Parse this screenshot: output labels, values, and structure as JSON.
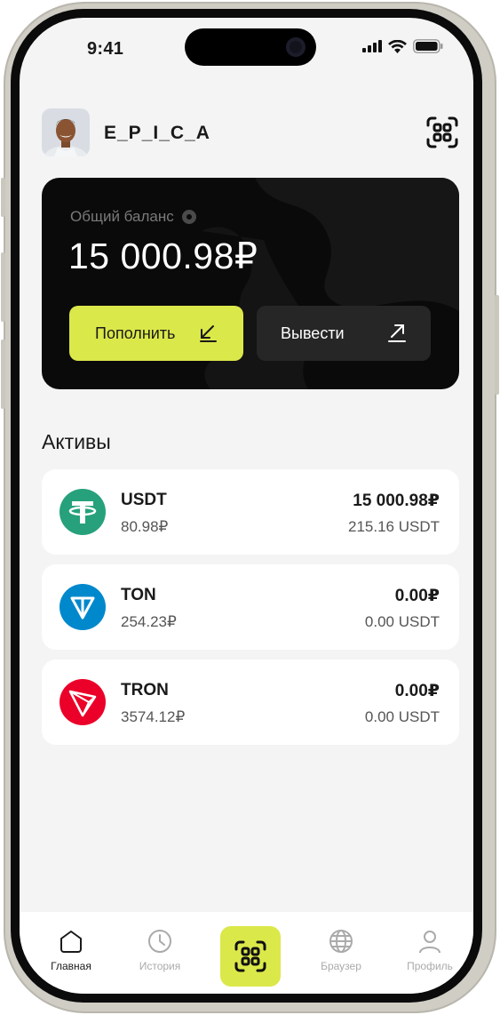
{
  "status_bar": {
    "time": "9:41"
  },
  "header": {
    "username": "E_P_I_C_A"
  },
  "balance": {
    "label": "Общий баланс",
    "amount": "15 000.98₽",
    "topup_label": "Пополнить",
    "withdraw_label": "Вывести"
  },
  "assets": {
    "title": "Активы",
    "items": [
      {
        "name": "USDT",
        "sub": "80.98₽",
        "value": "15 000.98₽",
        "sub2": "215.16 USDT",
        "icon": "tether-icon",
        "color": "#26a17b"
      },
      {
        "name": "TON",
        "sub": "254.23₽",
        "value": "0.00₽",
        "sub2": "0.00 USDT",
        "icon": "ton-icon",
        "color": "#0088cc"
      },
      {
        "name": "TRON",
        "sub": "3574.12₽",
        "value": "0.00₽",
        "sub2": "0.00 USDT",
        "icon": "tron-icon",
        "color": "#eb0029"
      }
    ]
  },
  "tabbar": {
    "home": "Главная",
    "history": "История",
    "browser": "Браузер",
    "profile": "Профиль"
  },
  "colors": {
    "accent": "#dbe84a",
    "card": "#0a0a0a",
    "background": "#f4f4f4"
  }
}
